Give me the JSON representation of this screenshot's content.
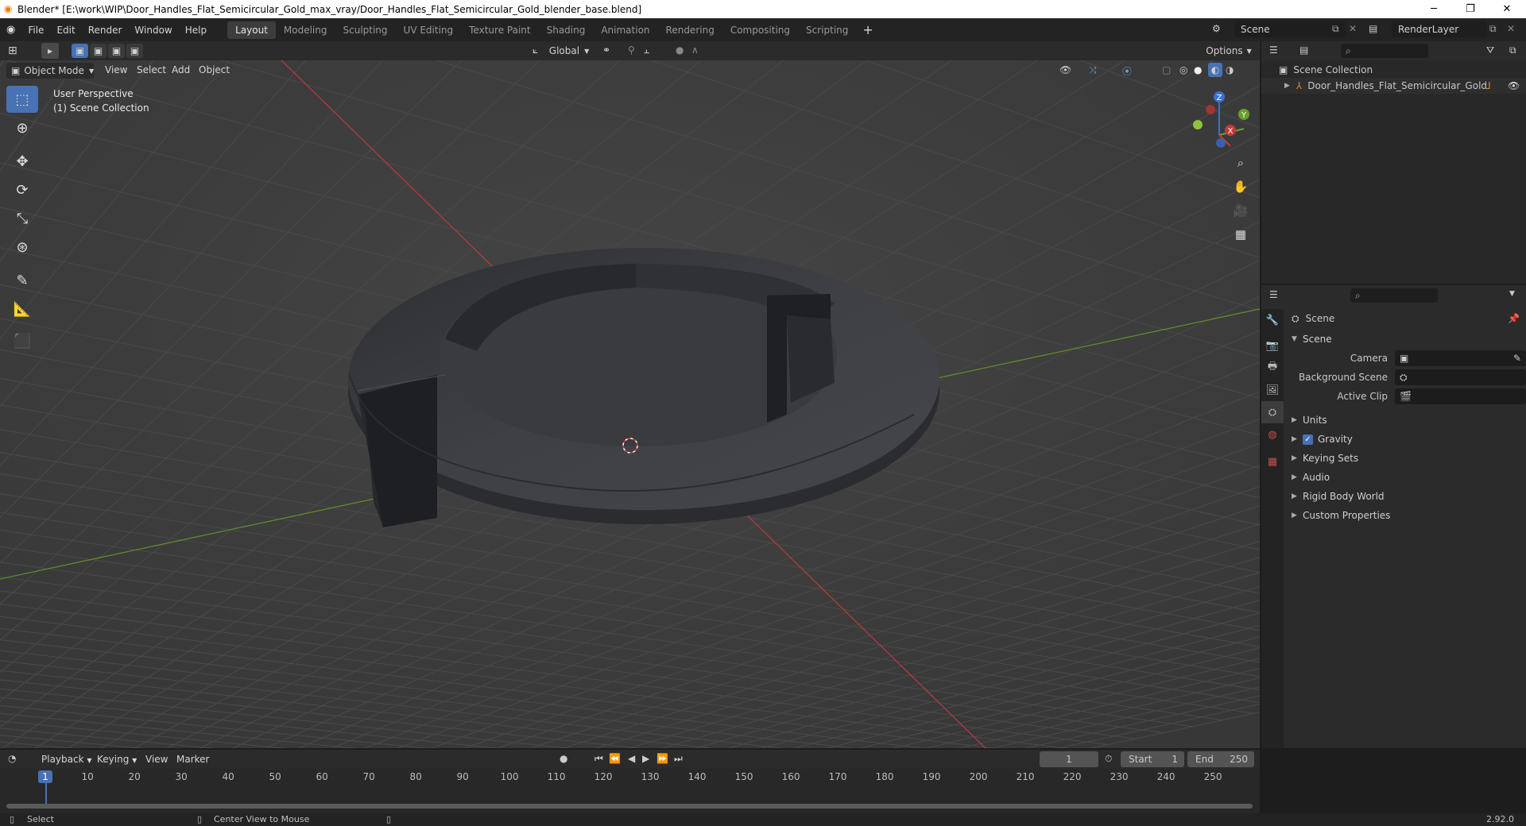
{
  "title_bar": {
    "title": "Blender* [E:\\work\\WIP\\Door_Handles_Flat_Semicircular_Gold_max_vray/Door_Handles_Flat_Semicircular_Gold_blender_base.blend]",
    "minimize": "─",
    "maximize": "❐",
    "close": "✕"
  },
  "menu": [
    "File",
    "Edit",
    "Render",
    "Window",
    "Help"
  ],
  "workspaces": [
    "Layout",
    "Modeling",
    "Sculpting",
    "UV Editing",
    "Texture Paint",
    "Shading",
    "Animation",
    "Rendering",
    "Compositing",
    "Scripting"
  ],
  "active_workspace": "Layout",
  "scene_selector": "Scene",
  "view_layer_selector": "RenderLayer",
  "viewport": {
    "transform_orientation": "Global",
    "options_label": "Options",
    "mode": "Object Mode",
    "menus": [
      "View",
      "Select",
      "Add",
      "Object"
    ],
    "overlay_line1": "User Perspective",
    "overlay_line2": "(1) Scene Collection",
    "gizmo": {
      "x": "X",
      "y": "Y",
      "z": "Z"
    }
  },
  "outliner": {
    "root": "Scene Collection",
    "items": [
      {
        "name": "Door_Handles_Flat_Semicircular_Gold"
      }
    ]
  },
  "properties": {
    "context": "Scene",
    "section": "Scene",
    "fields": [
      {
        "label": "Camera",
        "value": ""
      },
      {
        "label": "Background Scene",
        "value": ""
      },
      {
        "label": "Active Clip",
        "value": ""
      }
    ],
    "panels": [
      "Units",
      "Gravity",
      "Keying Sets",
      "Audio",
      "Rigid Body World",
      "Custom Properties"
    ],
    "gravity_checked": true
  },
  "timeline": {
    "menus": [
      "Playback",
      "Keying",
      "View",
      "Marker"
    ],
    "current_frame": "1",
    "start_label": "Start",
    "start": "1",
    "end_label": "End",
    "end": "250",
    "ticks": [
      "1",
      "10",
      "20",
      "30",
      "40",
      "50",
      "60",
      "70",
      "80",
      "90",
      "100",
      "110",
      "120",
      "130",
      "140",
      "150",
      "160",
      "170",
      "180",
      "190",
      "200",
      "210",
      "220",
      "230",
      "240",
      "250"
    ]
  },
  "status_bar": {
    "left": "Select",
    "middle": "Center View to Mouse",
    "version": "2.92.0"
  },
  "colors": {
    "accent": "#4772b3",
    "x_axis": "#c23a3a",
    "y_axis": "#6a9e2a",
    "z_axis": "#3b6fd6",
    "grid": "#454545"
  }
}
